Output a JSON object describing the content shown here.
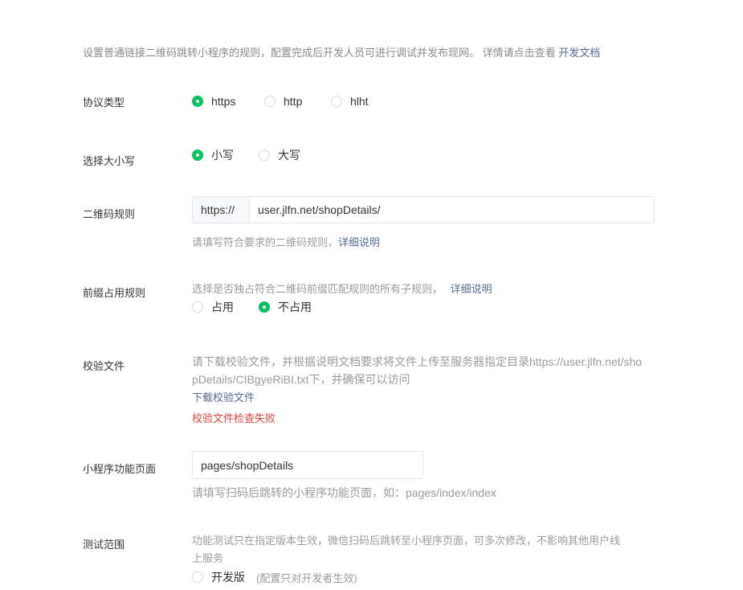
{
  "intro": {
    "text": "设置普通链接二维码跳转小程序的规则，配置完成后开发人员可进行调试并发布现网。 详情请点击查看 ",
    "link": "开发文档"
  },
  "protocol": {
    "label": "协议类型",
    "options": [
      "https",
      "http",
      "hlht"
    ],
    "selected": "https"
  },
  "case": {
    "label": "选择大小写",
    "options": [
      "小写",
      "大写"
    ],
    "selected": "小写"
  },
  "qr_rule": {
    "label": "二维码规则",
    "prefix": "https://",
    "value": "user.jlfn.net/shopDetails/",
    "hint": "请填写符合要求的二维码规则，",
    "hint_link": "详细说明"
  },
  "prefix_rule": {
    "label": "前缀占用规则",
    "desc": "选择是否独占符合二维码前缀匹配规则的所有子规则，",
    "desc_link": "详细说明",
    "options": [
      "占用",
      "不占用"
    ],
    "selected": "不占用"
  },
  "verify_file": {
    "label": "校验文件",
    "desc_line1": "请下载校验文件，并根据说明文档要求将文件上传至服务器指定目录https://user.jlfn.net/sho",
    "desc_line2": "pDetails/CIBgyeRiBI.txt下，并确保可以访问",
    "download_link": "下载校验文件",
    "error": "校验文件检查失败"
  },
  "page": {
    "label": "小程序功能页面",
    "value": "pages/shopDetails",
    "hint": "请填写扫码后跳转的小程序功能页面，如：pages/index/index"
  },
  "test_scope": {
    "label": "测试范围",
    "desc_line1": "功能测试只在指定版本生效，微信扫码后跳转至小程序页面，可多次修改，不影响其他用户线",
    "desc_line2": "上服务",
    "option": "开发版",
    "option_note": "(配置只对开发者生效)"
  },
  "colors": {
    "accent": "#07c160",
    "link": "#576b95",
    "error": "#e64340"
  }
}
